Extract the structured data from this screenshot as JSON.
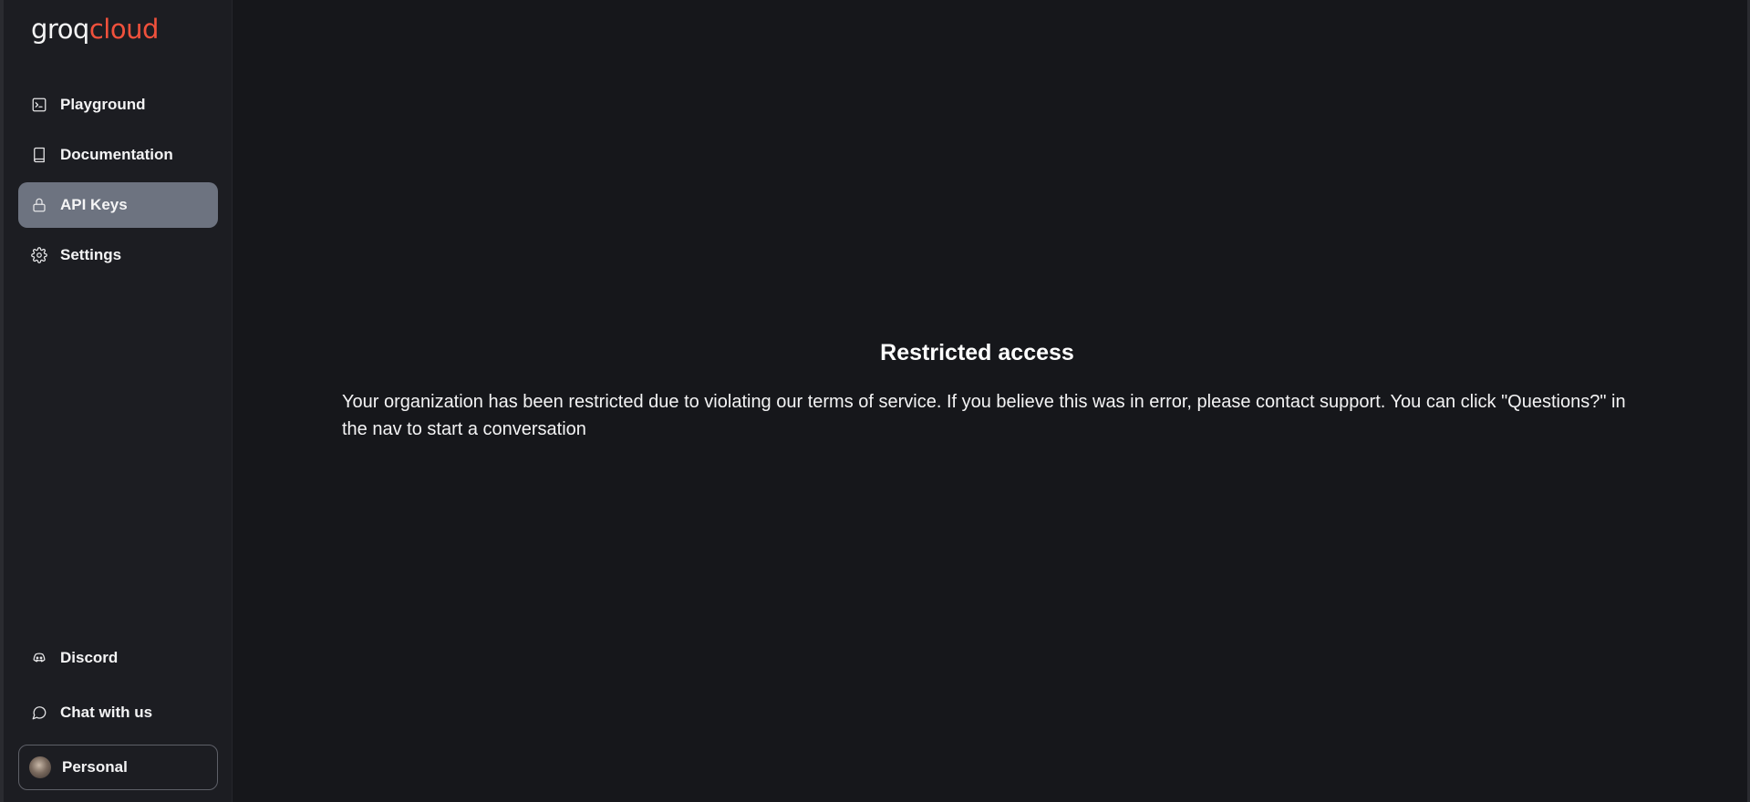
{
  "logo": {
    "part1": "groq",
    "part2": "cloud"
  },
  "sidebar": {
    "items": [
      {
        "label": "Playground",
        "icon": "terminal-icon"
      },
      {
        "label": "Documentation",
        "icon": "book-icon"
      },
      {
        "label": "API Keys",
        "icon": "lock-icon",
        "active": true
      },
      {
        "label": "Settings",
        "icon": "gear-icon"
      }
    ],
    "bottom_items": [
      {
        "label": "Discord",
        "icon": "discord-icon"
      },
      {
        "label": "Chat with us",
        "icon": "chat-bubble-icon"
      }
    ],
    "profile": {
      "label": "Personal",
      "icon": "avatar"
    }
  },
  "main": {
    "title": "Restricted access",
    "message": "Your organization has been restricted due to violating our terms of service. If you believe this was in error, please contact support. You can click \"Questions?\" in the nav to start a conversation"
  },
  "colors": {
    "background": "#16171b",
    "sidebar": "#1c1d22",
    "active_item": "#6d7380",
    "logo_accent": "#f0513c"
  }
}
